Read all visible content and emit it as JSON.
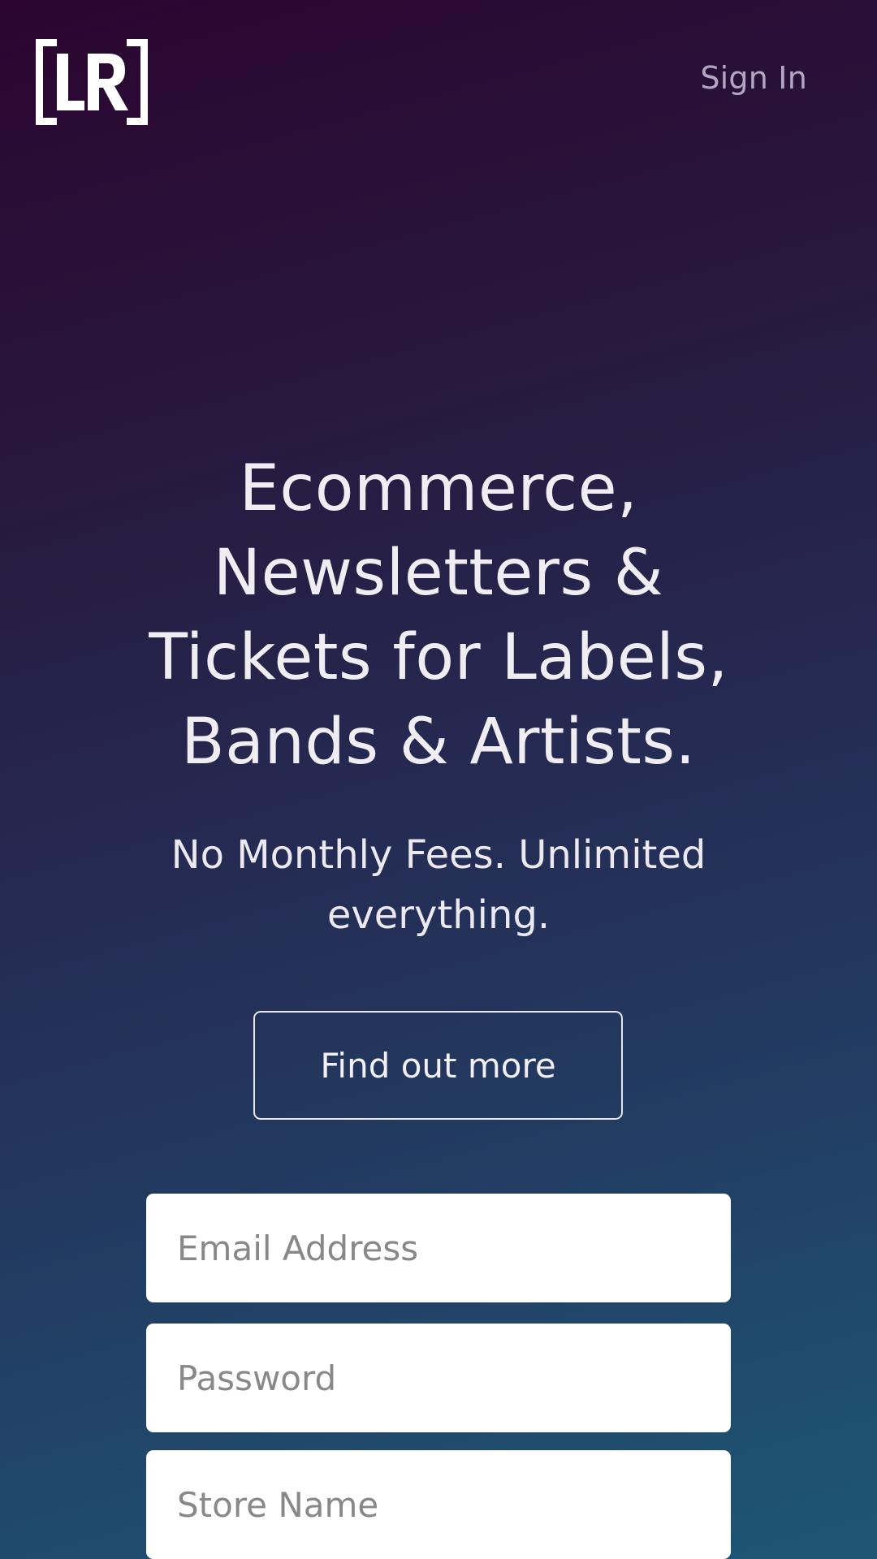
{
  "header": {
    "logo_text": "LR",
    "sign_in_label": "Sign In"
  },
  "hero": {
    "headline_lines": [
      "Ecommerce,",
      "Newsletters &",
      "Tickets for Labels,",
      "Bands & Artists."
    ],
    "subheadline_lines": [
      "No Monthly Fees. Unlimited",
      "everything."
    ],
    "cta_label": "Find out more"
  },
  "signup_form": {
    "email_placeholder": "Email Address",
    "email_value": "",
    "password_placeholder": "Password",
    "password_value": "",
    "store_placeholder": "Store Name",
    "store_value": ""
  },
  "colors": {
    "background_top": "#2b0530",
    "background_bottom": "#1e5775",
    "sign_in_text": "#b3a6c2",
    "text": "#efecf2",
    "field_background": "#ffffff"
  }
}
